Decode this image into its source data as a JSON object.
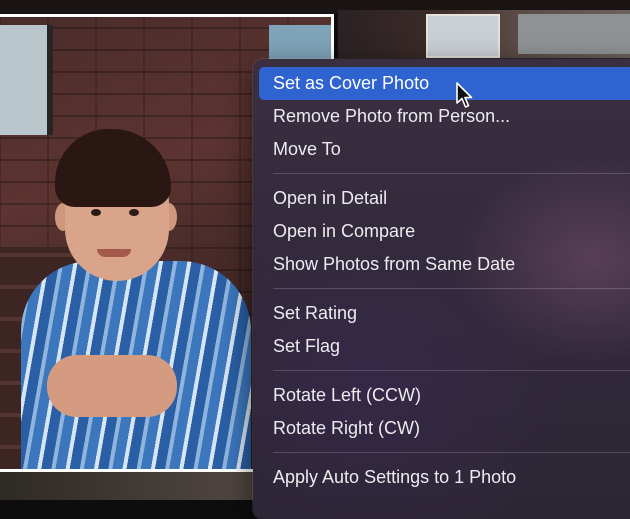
{
  "context_menu": {
    "items": [
      {
        "label": "Set as Cover Photo",
        "highlighted": true
      },
      {
        "label": "Remove Photo from Person..."
      },
      {
        "label": "Move To"
      },
      {
        "label": "Open in Detail"
      },
      {
        "label": "Open in Compare"
      },
      {
        "label": "Show Photos from Same Date"
      },
      {
        "label": "Set Rating"
      },
      {
        "label": "Set Flag"
      },
      {
        "label": "Rotate Left (CCW)"
      },
      {
        "label": "Rotate Right (CW)"
      },
      {
        "label": "Apply Auto Settings to 1 Photo"
      }
    ]
  },
  "colors": {
    "menu_highlight": "#2f63d0",
    "menu_text": "#ecebee",
    "selection_border": "#ffffff"
  },
  "icons": {
    "cursor": "mouse-pointer-icon"
  }
}
